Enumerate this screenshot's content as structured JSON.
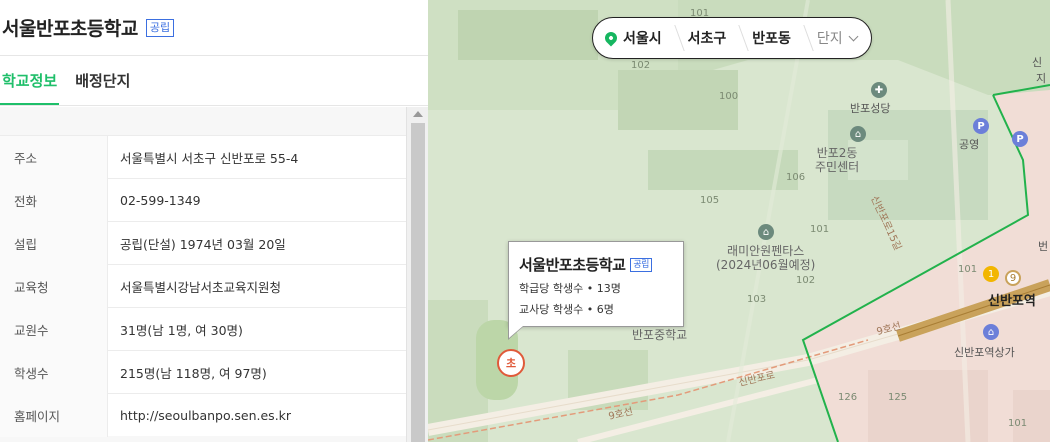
{
  "school": {
    "name": "서울반포초등학교",
    "type_badge": "공립"
  },
  "tabs": [
    {
      "label": "학교정보",
      "active": true
    },
    {
      "label": "배정단지",
      "active": false
    }
  ],
  "info": [
    {
      "label": "주소",
      "value": "서울특별시 서초구 신반포로 55-4"
    },
    {
      "label": "전화",
      "value": "02-599-1349"
    },
    {
      "label": "설립",
      "value": "공립(단설) 1974년 03월 20일"
    },
    {
      "label": "교육청",
      "value": "서울특별시강남서초교육지원청"
    },
    {
      "label": "교원수",
      "value": "31명(남 1명, 여 30명)"
    },
    {
      "label": "학생수",
      "value": "215명(남 118명, 여 97명)"
    },
    {
      "label": "홈페이지",
      "value": "http://seoulbanpo.sen.es.kr"
    }
  ],
  "breadcrumb": {
    "items": [
      "서울시",
      "서초구",
      "반포동"
    ],
    "dropdown": "단지"
  },
  "popup": {
    "title": "서울반포초등학교",
    "badge": "공립",
    "line1": "학급당 학생수 • 13명",
    "line2": "교사당 학생수 • 6명"
  },
  "marker_label": "초",
  "map_labels": {
    "l101top": "101",
    "l102": "102",
    "l100": "100",
    "l105": "105",
    "l106": "106",
    "l101b": "101",
    "l103": "103",
    "l102b": "102",
    "l101c": "101",
    "l126": "126",
    "l125": "125",
    "l101d": "101",
    "church": "반포성당",
    "center": "반포2동\n주민센터",
    "pentas": "래미안원펜타스\n(2024년06월예정)",
    "middle_school": "반포중학교",
    "station": "신반포역",
    "mall": "신반포역상가",
    "parking": "공영",
    "shin": "신",
    "ji": "지",
    "beon": "번",
    "road1": "신반포로",
    "road2": "9호선",
    "road3": "9호선",
    "road4": "신반포로15길"
  },
  "colors": {
    "accent_green": "#1fbf6a",
    "badge_blue": "#3b6fe0",
    "marker_red": "#e05a3a",
    "boundary_green": "#22b24c"
  }
}
